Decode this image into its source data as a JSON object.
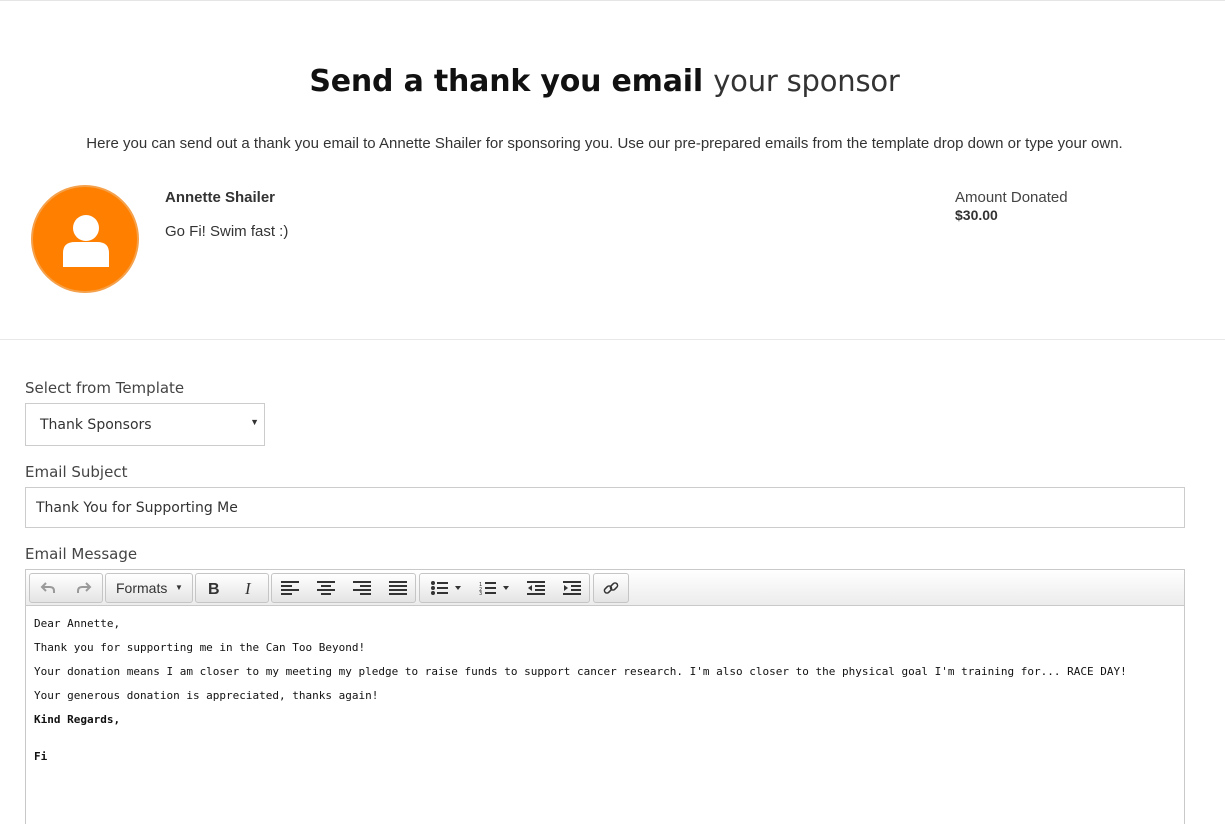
{
  "header": {
    "title_strong": "Send a thank you email",
    "title_light": "your sponsor",
    "intro": "Here you can send out a thank you email to Annette Shailer for sponsoring you. Use our pre-prepared emails from the template drop down or type your own."
  },
  "sponsor": {
    "avatar_color": "#FF8000",
    "name": "Annette Shailer",
    "message": "Go Fi! Swim fast :)",
    "amount_label": "Amount Donated",
    "amount_value": "$30.00"
  },
  "form": {
    "template_label": "Select from Template",
    "template_selected": "Thank Sponsors",
    "subject_label": "Email Subject",
    "subject_value": "Thank You for Supporting Me",
    "message_label": "Email Message"
  },
  "toolbar": {
    "formats_label": "Formats",
    "buttons": [
      "undo-icon",
      "redo-icon",
      "bold-icon",
      "italic-icon",
      "align-left-icon",
      "align-center-icon",
      "align-right-icon",
      "align-justify-icon",
      "bullet-list-icon",
      "numbered-list-icon",
      "outdent-icon",
      "indent-icon",
      "link-icon"
    ]
  },
  "editor": {
    "lines": [
      "Dear Annette,",
      "Thank you for supporting me in the Can Too Beyond!",
      "Your donation means I am closer to my meeting my pledge to raise funds to support cancer research. I'm also closer to the physical goal I'm training for... RACE DAY!",
      "Your generous donation is appreciated, thanks again!",
      "Kind Regards,",
      "Fi"
    ]
  }
}
